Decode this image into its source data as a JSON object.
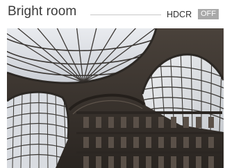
{
  "header": {
    "title": "Bright room",
    "mode_label": "HDCR",
    "mode_state": "OFF"
  },
  "photo": {
    "name": "preview-photo"
  },
  "colors": {
    "title": "#3a3a3a",
    "divider": "#c8c8c8",
    "badge_bg": "#a9a9a9",
    "badge_text": "#ffffff"
  }
}
